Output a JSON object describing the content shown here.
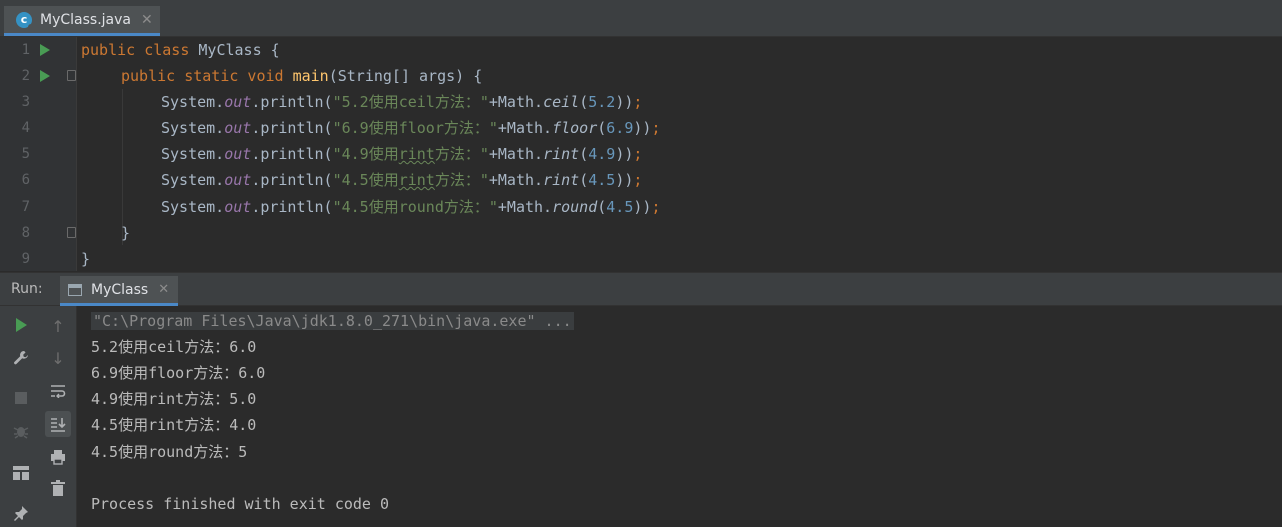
{
  "editor_tab": {
    "filename": "MyClass.java",
    "close": "✕"
  },
  "code_lines": [
    {
      "n": "1"
    },
    {
      "n": "2"
    },
    {
      "n": "3"
    },
    {
      "n": "4"
    },
    {
      "n": "5"
    },
    {
      "n": "6"
    },
    {
      "n": "7"
    },
    {
      "n": "8"
    },
    {
      "n": "9"
    }
  ],
  "code": {
    "l1": {
      "kw": "public class ",
      "name": "MyClass",
      "brace": " {"
    },
    "l2": {
      "kw": "public static void ",
      "fn": "main",
      "params": "(String[] args) {"
    },
    "l3": {
      "sys": "System.",
      "out": "out",
      "println": ".println(",
      "str": "\"5.2使用ceil方法：\"",
      "plus": "+Math.",
      "method": "ceil",
      "open": "(",
      "num": "5.2",
      "close": "))",
      "semi": ";"
    },
    "l4": {
      "sys": "System.",
      "out": "out",
      "println": ".println(",
      "str": "\"6.9使用floor方法：\"",
      "plus": "+Math.",
      "method": "floor",
      "open": "(",
      "num": "6.9",
      "close": "))",
      "semi": ";"
    },
    "l5": {
      "sys": "System.",
      "out": "out",
      "println": ".println(",
      "str_a": "\"4.9使用",
      "str_typo": "rint",
      "str_b": "方法：\"",
      "plus": "+Math.",
      "method": "rint",
      "open": "(",
      "num": "4.9",
      "close": "))",
      "semi": ";"
    },
    "l6": {
      "sys": "System.",
      "out": "out",
      "println": ".println(",
      "str_a": "\"4.5使用",
      "str_typo": "rint",
      "str_b": "方法：\"",
      "plus": "+Math.",
      "method": "rint",
      "open": "(",
      "num": "4.5",
      "close": "))",
      "semi": ";"
    },
    "l7": {
      "sys": "System.",
      "out": "out",
      "println": ".println(",
      "str": "\"4.5使用round方法：\"",
      "plus": "+Math.",
      "method": "round",
      "open": "(",
      "num": "4.5",
      "close": "))",
      "semi": ";"
    },
    "l8": {
      "text": "}"
    },
    "l9": {
      "text": "}"
    }
  },
  "run_panel": {
    "label": "Run:",
    "tab": "MyClass",
    "close": "✕"
  },
  "console": {
    "command": "\"C:\\Program Files\\Java\\jdk1.8.0_271\\bin\\java.exe\" ...",
    "output": [
      "5.2使用ceil方法：6.0",
      "6.9使用floor方法：6.0",
      "4.9使用rint方法：5.0",
      "4.5使用rint方法：4.0",
      "4.5使用round方法：5"
    ],
    "exit": "Process finished with exit code 0"
  },
  "toolbar_icons": {
    "run": "play-icon",
    "wrench": "wrench-icon",
    "stop": "stop-icon",
    "bug": "debug-icon",
    "layout": "layout-icon",
    "pin": "pin-icon",
    "up": "arrow-up-icon",
    "down": "arrow-down-icon",
    "wrap": "soft-wrap-icon",
    "scroll": "scroll-to-end-icon",
    "print": "print-icon",
    "trash": "trash-icon"
  },
  "colors": {
    "keyword": "#cc7832",
    "function": "#ffc66d",
    "string": "#6a8759",
    "number": "#6897bb",
    "field": "#9876aa",
    "text": "#a9b7c6",
    "accent": "#4a88c7"
  }
}
